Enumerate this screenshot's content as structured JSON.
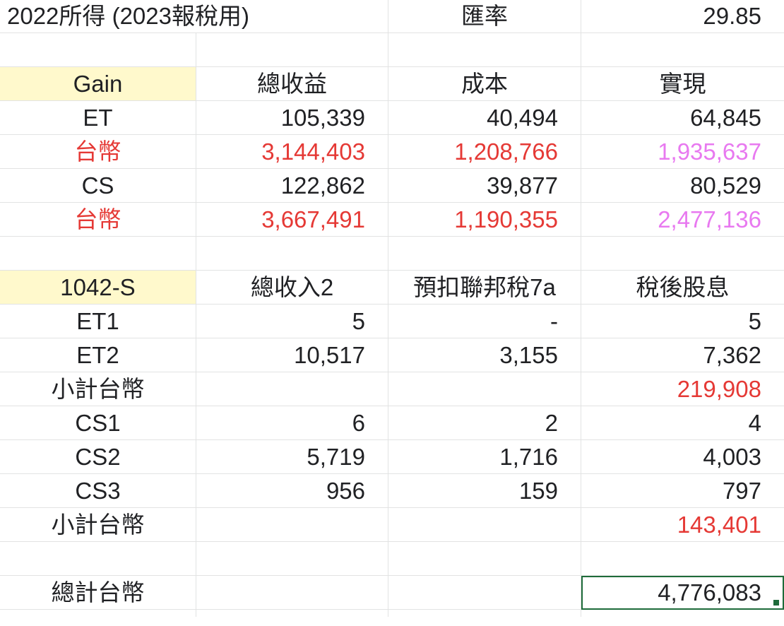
{
  "colors": {
    "gridline": "#e2e3e3",
    "yellow_fill": "#fff9cc",
    "red_text": "#e53935",
    "pink_text": "#e879f0",
    "selected_border": "#1e6b3a",
    "default_text": "#202124"
  },
  "rows": [
    [
      {
        "text": "2022所得 (2023報稅用)",
        "align": "left",
        "span": 2
      },
      null,
      {
        "text": "匯率",
        "align": "center"
      },
      {
        "text": "29.85",
        "align": "right"
      }
    ],
    [
      null,
      null,
      null,
      null
    ],
    [
      {
        "text": "Gain",
        "align": "center",
        "fill": "yellow"
      },
      {
        "text": "總收益",
        "align": "center"
      },
      {
        "text": "成本",
        "align": "center"
      },
      {
        "text": "實現",
        "align": "center"
      }
    ],
    [
      {
        "text": "ET",
        "align": "center"
      },
      {
        "text": "105,339",
        "align": "right"
      },
      {
        "text": "40,494",
        "align": "right"
      },
      {
        "text": "64,845",
        "align": "right"
      }
    ],
    [
      {
        "text": "台幣",
        "align": "center",
        "color": "red"
      },
      {
        "text": "3,144,403",
        "align": "right",
        "color": "red"
      },
      {
        "text": "1,208,766",
        "align": "right",
        "color": "red"
      },
      {
        "text": "1,935,637",
        "align": "right",
        "color": "pink"
      }
    ],
    [
      {
        "text": "CS",
        "align": "center"
      },
      {
        "text": "122,862",
        "align": "right"
      },
      {
        "text": "39,877",
        "align": "right"
      },
      {
        "text": "80,529",
        "align": "right"
      }
    ],
    [
      {
        "text": "台幣",
        "align": "center",
        "color": "red"
      },
      {
        "text": "3,667,491",
        "align": "right",
        "color": "red"
      },
      {
        "text": "1,190,355",
        "align": "right",
        "color": "red"
      },
      {
        "text": "2,477,136",
        "align": "right",
        "color": "pink"
      }
    ],
    [
      null,
      null,
      null,
      null
    ],
    [
      {
        "text": "1042-S",
        "align": "center",
        "fill": "yellow"
      },
      {
        "text": "總收入2",
        "align": "center"
      },
      {
        "text": "預扣聯邦稅7a",
        "align": "center"
      },
      {
        "text": "稅後股息",
        "align": "center"
      }
    ],
    [
      {
        "text": "ET1",
        "align": "center"
      },
      {
        "text": "5",
        "align": "right"
      },
      {
        "text": "-",
        "align": "right"
      },
      {
        "text": "5",
        "align": "right"
      }
    ],
    [
      {
        "text": "ET2",
        "align": "center"
      },
      {
        "text": "10,517",
        "align": "right"
      },
      {
        "text": "3,155",
        "align": "right"
      },
      {
        "text": "7,362",
        "align": "right"
      }
    ],
    [
      {
        "text": "小計台幣",
        "align": "center"
      },
      null,
      null,
      {
        "text": "219,908",
        "align": "right",
        "color": "red"
      }
    ],
    [
      {
        "text": "CS1",
        "align": "center"
      },
      {
        "text": "6",
        "align": "right"
      },
      {
        "text": "2",
        "align": "right"
      },
      {
        "text": "4",
        "align": "right"
      }
    ],
    [
      {
        "text": "CS2",
        "align": "center"
      },
      {
        "text": "5,719",
        "align": "right"
      },
      {
        "text": "1,716",
        "align": "right"
      },
      {
        "text": "4,003",
        "align": "right"
      }
    ],
    [
      {
        "text": "CS3",
        "align": "center"
      },
      {
        "text": "956",
        "align": "right"
      },
      {
        "text": "159",
        "align": "right"
      },
      {
        "text": "797",
        "align": "right"
      }
    ],
    [
      {
        "text": "小計台幣",
        "align": "center"
      },
      null,
      null,
      {
        "text": "143,401",
        "align": "right",
        "color": "red"
      }
    ],
    [
      null,
      null,
      null,
      null
    ],
    [
      {
        "text": "總計台幣",
        "align": "center"
      },
      null,
      null,
      {
        "text": "4,776,083",
        "align": "right",
        "selected": true
      }
    ]
  ]
}
